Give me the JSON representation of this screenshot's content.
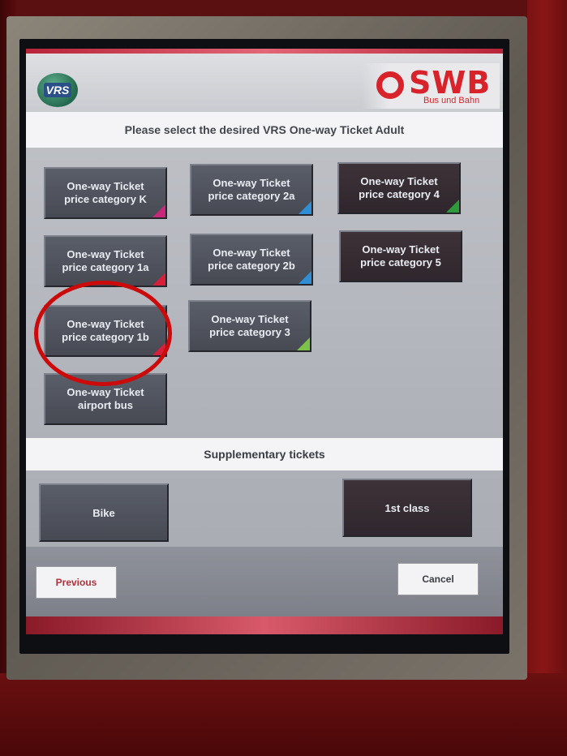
{
  "logos": {
    "vrs": "VRS",
    "swb": "SWB",
    "swb_sub": "Bus und Bahn"
  },
  "header": {
    "title": "Please select the desired VRS One-way Ticket Adult"
  },
  "tickets": [
    {
      "label": "One-way Ticket\nprice category K",
      "accent": "#c8287a"
    },
    {
      "label": "One-way Ticket\nprice category 1a",
      "accent": "#d61f3a"
    },
    {
      "label": "One-way Ticket\nprice category 1b",
      "accent": "#d61f3a"
    },
    {
      "label": "One-way Ticket\nairport bus",
      "accent": ""
    },
    {
      "label": "One-way Ticket\nprice category 2a",
      "accent": "#2e8fd6"
    },
    {
      "label": "One-way Ticket\nprice category 2b",
      "accent": "#2e8fd6"
    },
    {
      "label": "One-way Ticket\nprice category 3",
      "accent": "#7cc24a"
    },
    {
      "label": "One-way Ticket\nprice category 4",
      "accent": "#2e9a3c"
    },
    {
      "label": "One-way Ticket\nprice category 5",
      "accent": ""
    }
  ],
  "supplementary": {
    "title": "Supplementary tickets",
    "bike": "Bike",
    "first_class": "1st class"
  },
  "nav": {
    "previous": "Previous",
    "cancel": "Cancel"
  },
  "colors": {
    "highlight_circle": "#cc0a0a",
    "brand_red": "#d8232a",
    "previous_text": "#b0303a"
  }
}
